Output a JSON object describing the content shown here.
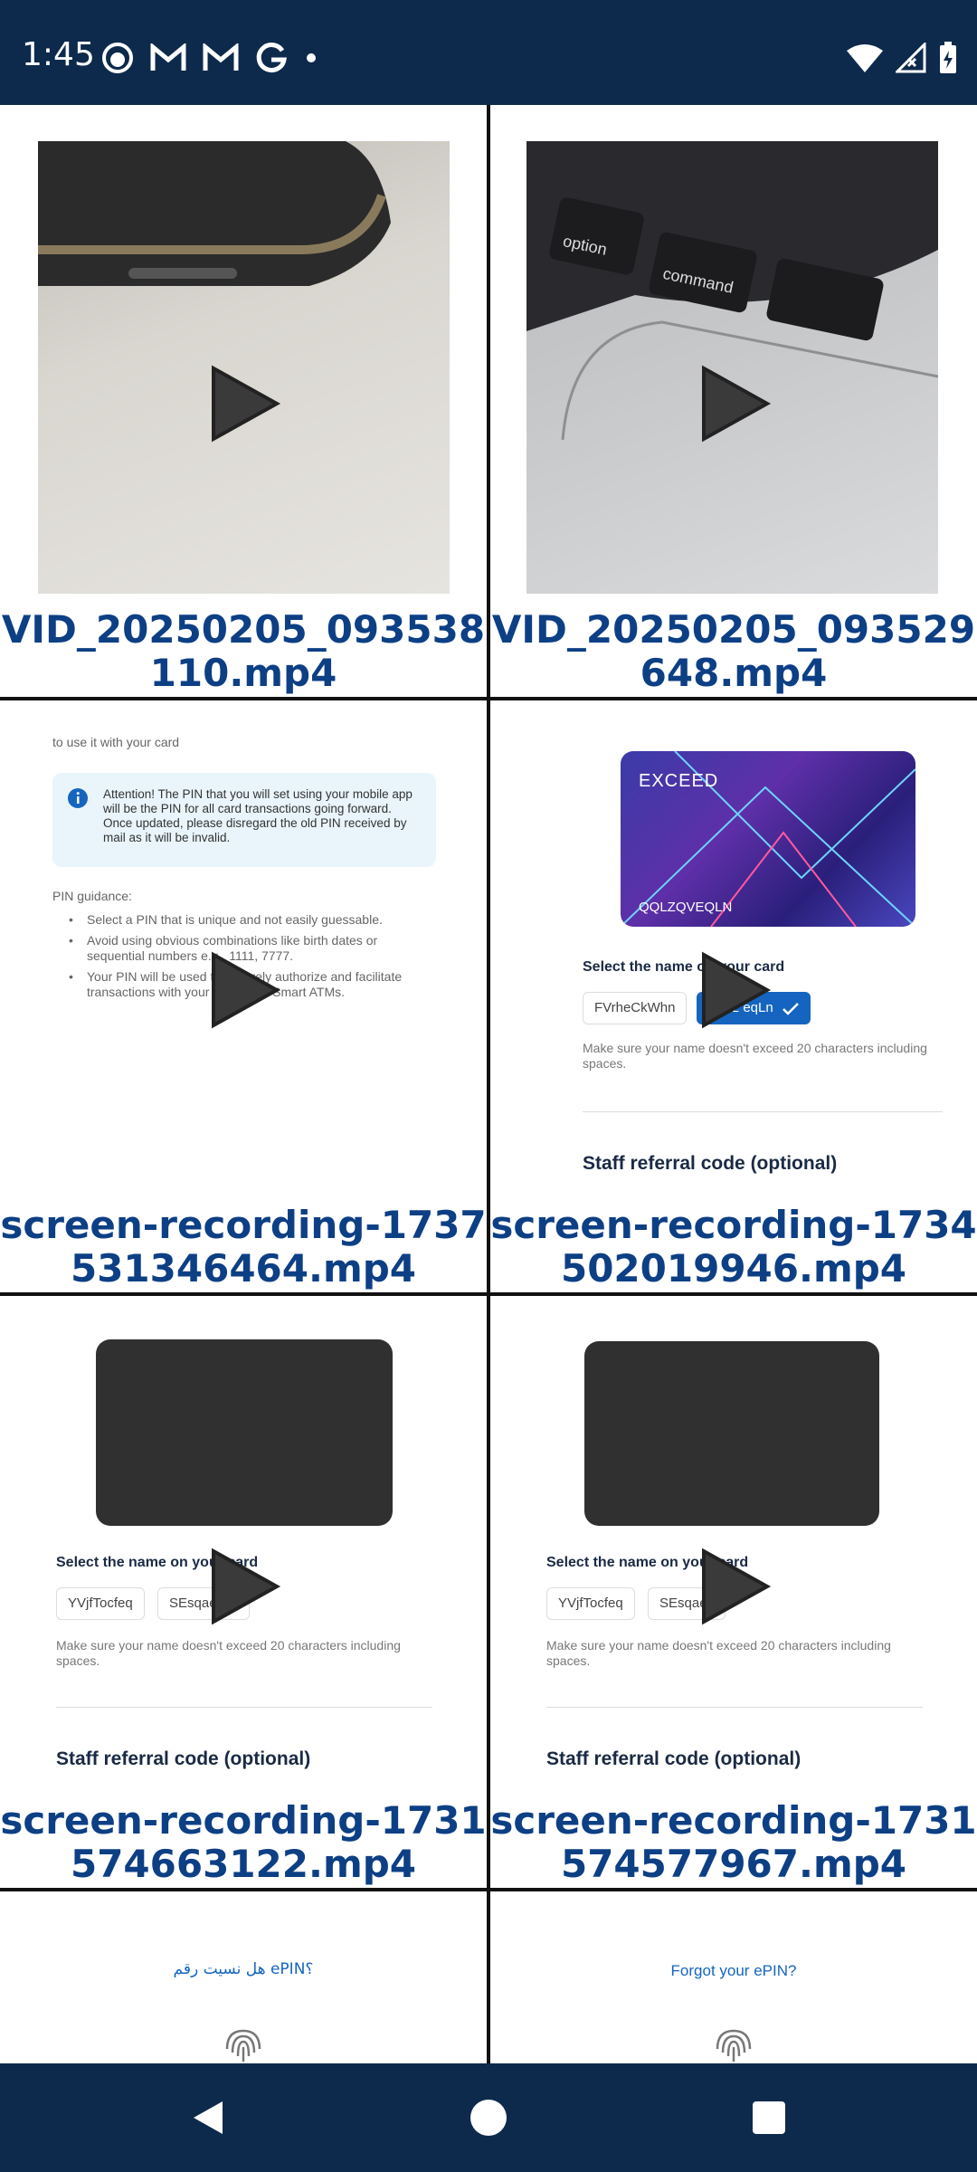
{
  "status_bar": {
    "time": "1:45",
    "notification_icons": [
      "face-icon",
      "gmail-icon",
      "gmail-icon",
      "google-icon",
      "dot-icon"
    ],
    "system_icons": [
      "wifi-icon",
      "signal-icon",
      "battery-charging-icon"
    ]
  },
  "gallery": {
    "items": [
      {
        "caption": "VID_20250205_093538110.mp4"
      },
      {
        "caption": "VID_20250205_093529648.mp4"
      },
      {
        "caption": "screen-recording-1737531346464.mp4",
        "top_text": "to use it with your card",
        "attention": "Attention! The PIN that you will set using your mobile app will be the PIN for all card transactions going forward. Once updated, please disregard the old PIN received by mail as it will be invalid.",
        "guidance_title": "PIN guidance:",
        "guidance": [
          "Select a PIN that is unique and not easily guessable.",
          "Avoid using obvious combinations like birth dates or sequential numbers e.g., 1111, 7777.",
          "Your PIN will be used to securely authorize and facilitate transactions with your      ATMs and Smart ATMs."
        ]
      },
      {
        "caption": "screen-recording-1734502019946.mp4",
        "card_brand": "EXCEED",
        "card_name": "QQLZQVEQLN",
        "select_label": "Select the name on your card",
        "chip1": "FVrheCkWhn",
        "chip2": "QQlz   eqLn",
        "hint": "Make sure your name doesn't exceed 20 characters including spaces.",
        "staff_label": "Staff referral code (optional)"
      },
      {
        "caption": "screen-recording-1731574663122.mp4",
        "select_label": "Select the name on your card",
        "chip1": "YVjfTocfeq",
        "chip2": "SEsqaev   O",
        "hint": "Make sure your name doesn't exceed 20 characters including spaces.",
        "staff_label": "Staff referral code (optional)"
      },
      {
        "caption": "screen-recording-1731574577967.mp4",
        "select_label": "Select the name on your card",
        "chip1": "YVjfTocfeq",
        "chip2": "SEsqaev",
        "hint": "Make sure your name doesn't exceed 20 characters including spaces.",
        "staff_label": "Staff referral code (optional)"
      },
      {
        "forgot_text": "هل نسيت رقم ePIN؟"
      },
      {
        "forgot_text": "Forgot your ePIN?"
      }
    ]
  },
  "nav_bar": {
    "buttons": [
      "back-icon",
      "home-icon",
      "recents-icon"
    ]
  }
}
